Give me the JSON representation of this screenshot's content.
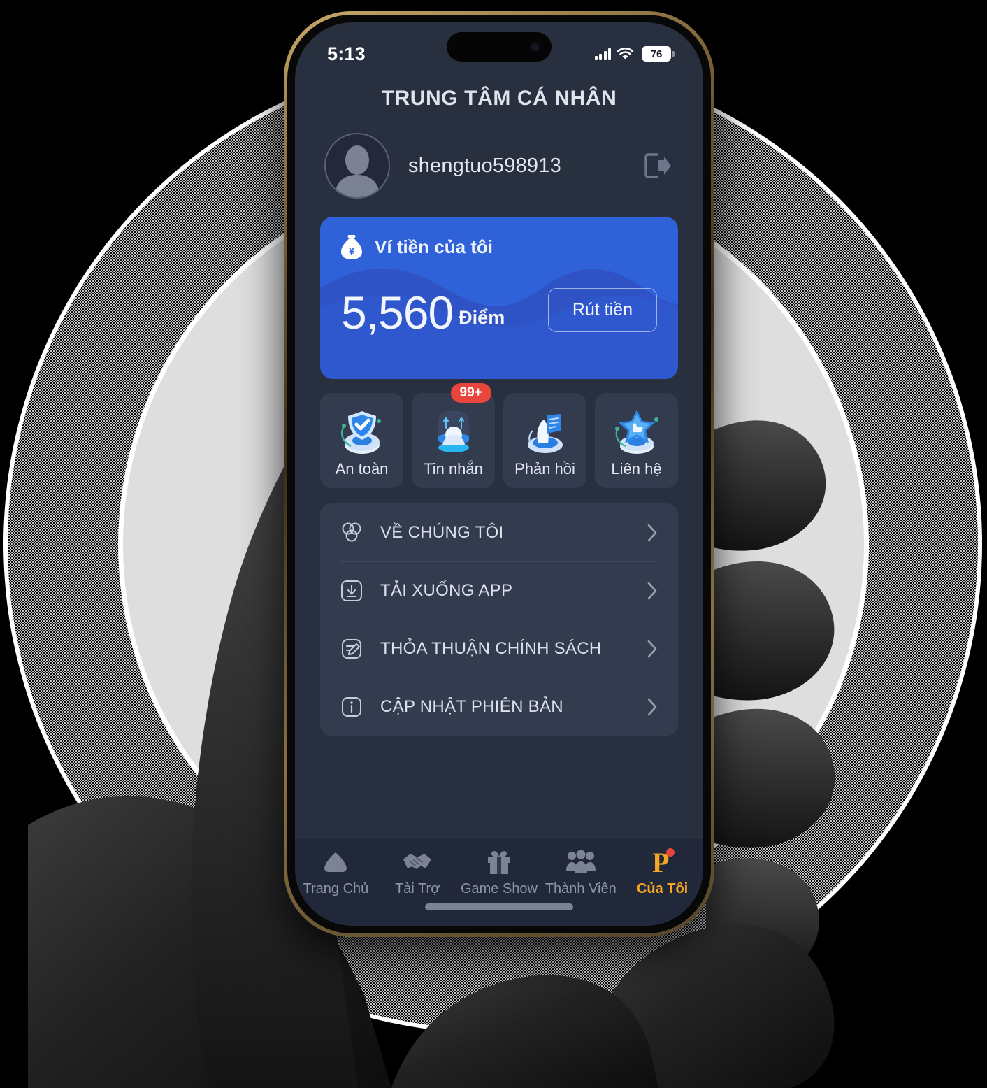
{
  "status_bar": {
    "time": "5:13",
    "battery_level": "76",
    "signal_icon": "cellular-bars-icon",
    "wifi_icon": "wifi-icon",
    "battery_icon": "battery-icon"
  },
  "header": {
    "title": "TRUNG TÂM CÁ NHÂN"
  },
  "profile": {
    "username": "shengtuo598913",
    "avatar_icon": "avatar-placeholder-icon",
    "logout_icon": "logout-icon"
  },
  "wallet": {
    "title": "Ví tiền của tôi",
    "icon": "money-bag-icon",
    "points": "5,560",
    "unit": "Điểm",
    "withdraw_label": "Rút tiền",
    "card_color": "#2f62d8",
    "wave_color": "#2f51c4"
  },
  "quick_actions": [
    {
      "label": "An toàn",
      "icon": "shield-check-3d-icon"
    },
    {
      "label": "Tin nhắn",
      "icon": "message-person-3d-icon",
      "badge": "99+"
    },
    {
      "label": "Phản hồi",
      "icon": "feedback-flag-3d-icon"
    },
    {
      "label": "Liên hệ",
      "icon": "contact-star-3d-icon"
    }
  ],
  "menu": [
    {
      "label": "VỀ CHÚNG TÔI",
      "icon": "about-circles-icon",
      "chevron": "chevron-right-icon"
    },
    {
      "label": "TẢI XUỐNG APP",
      "icon": "download-icon",
      "chevron": "chevron-right-icon"
    },
    {
      "label": "THỎA THUẬN CHÍNH SÁCH",
      "icon": "policy-edit-icon",
      "chevron": "chevron-right-icon"
    },
    {
      "label": "CẬP NHẬT PHIÊN BẢN",
      "icon": "info-icon",
      "chevron": "chevron-right-icon"
    }
  ],
  "tabbar": {
    "active_color": "#f5a623",
    "inactive_color": "#8d95a6",
    "items": [
      {
        "label": "Trang Chủ",
        "icon": "home-icon",
        "active": false
      },
      {
        "label": "Tài Trợ",
        "icon": "handshake-icon",
        "active": false
      },
      {
        "label": "Game Show",
        "icon": "gift-icon",
        "active": false
      },
      {
        "label": "Thành Viên",
        "icon": "members-icon",
        "active": false
      },
      {
        "label": "Của Tôi",
        "icon": "p-logo-icon",
        "active": true
      }
    ]
  },
  "theme": {
    "screen_bg": "#282f3f",
    "card_bg": "#333b4f",
    "tabbar_bg": "#21283a",
    "badge_red": "#e8453c"
  }
}
